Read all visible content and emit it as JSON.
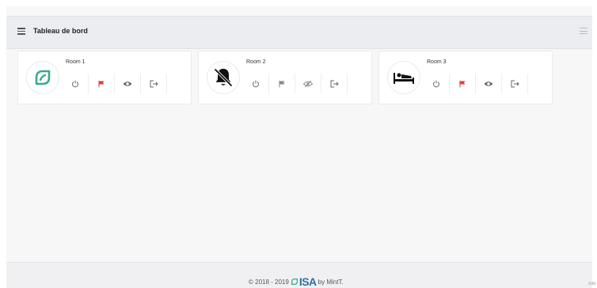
{
  "header": {
    "title": "Tableau de bord"
  },
  "rooms": [
    {
      "name": "Room 1",
      "icon": "leaf-icon",
      "flag_color": "#e53935"
    },
    {
      "name": "Room 2",
      "icon": "bell-off-icon",
      "flag_color": "#888888"
    },
    {
      "name": "Room 3",
      "icon": "bed-icon",
      "flag_color": "#e53935"
    }
  ],
  "footer": {
    "copyright": "© 2018 - 2019",
    "logo_text": "ISA",
    "credit": "by MintT."
  },
  "corner_note": "Edit",
  "colors": {
    "accent_green": "#3aa88f",
    "flag_red": "#e53935",
    "logo_blue": "#2f6fa8"
  }
}
